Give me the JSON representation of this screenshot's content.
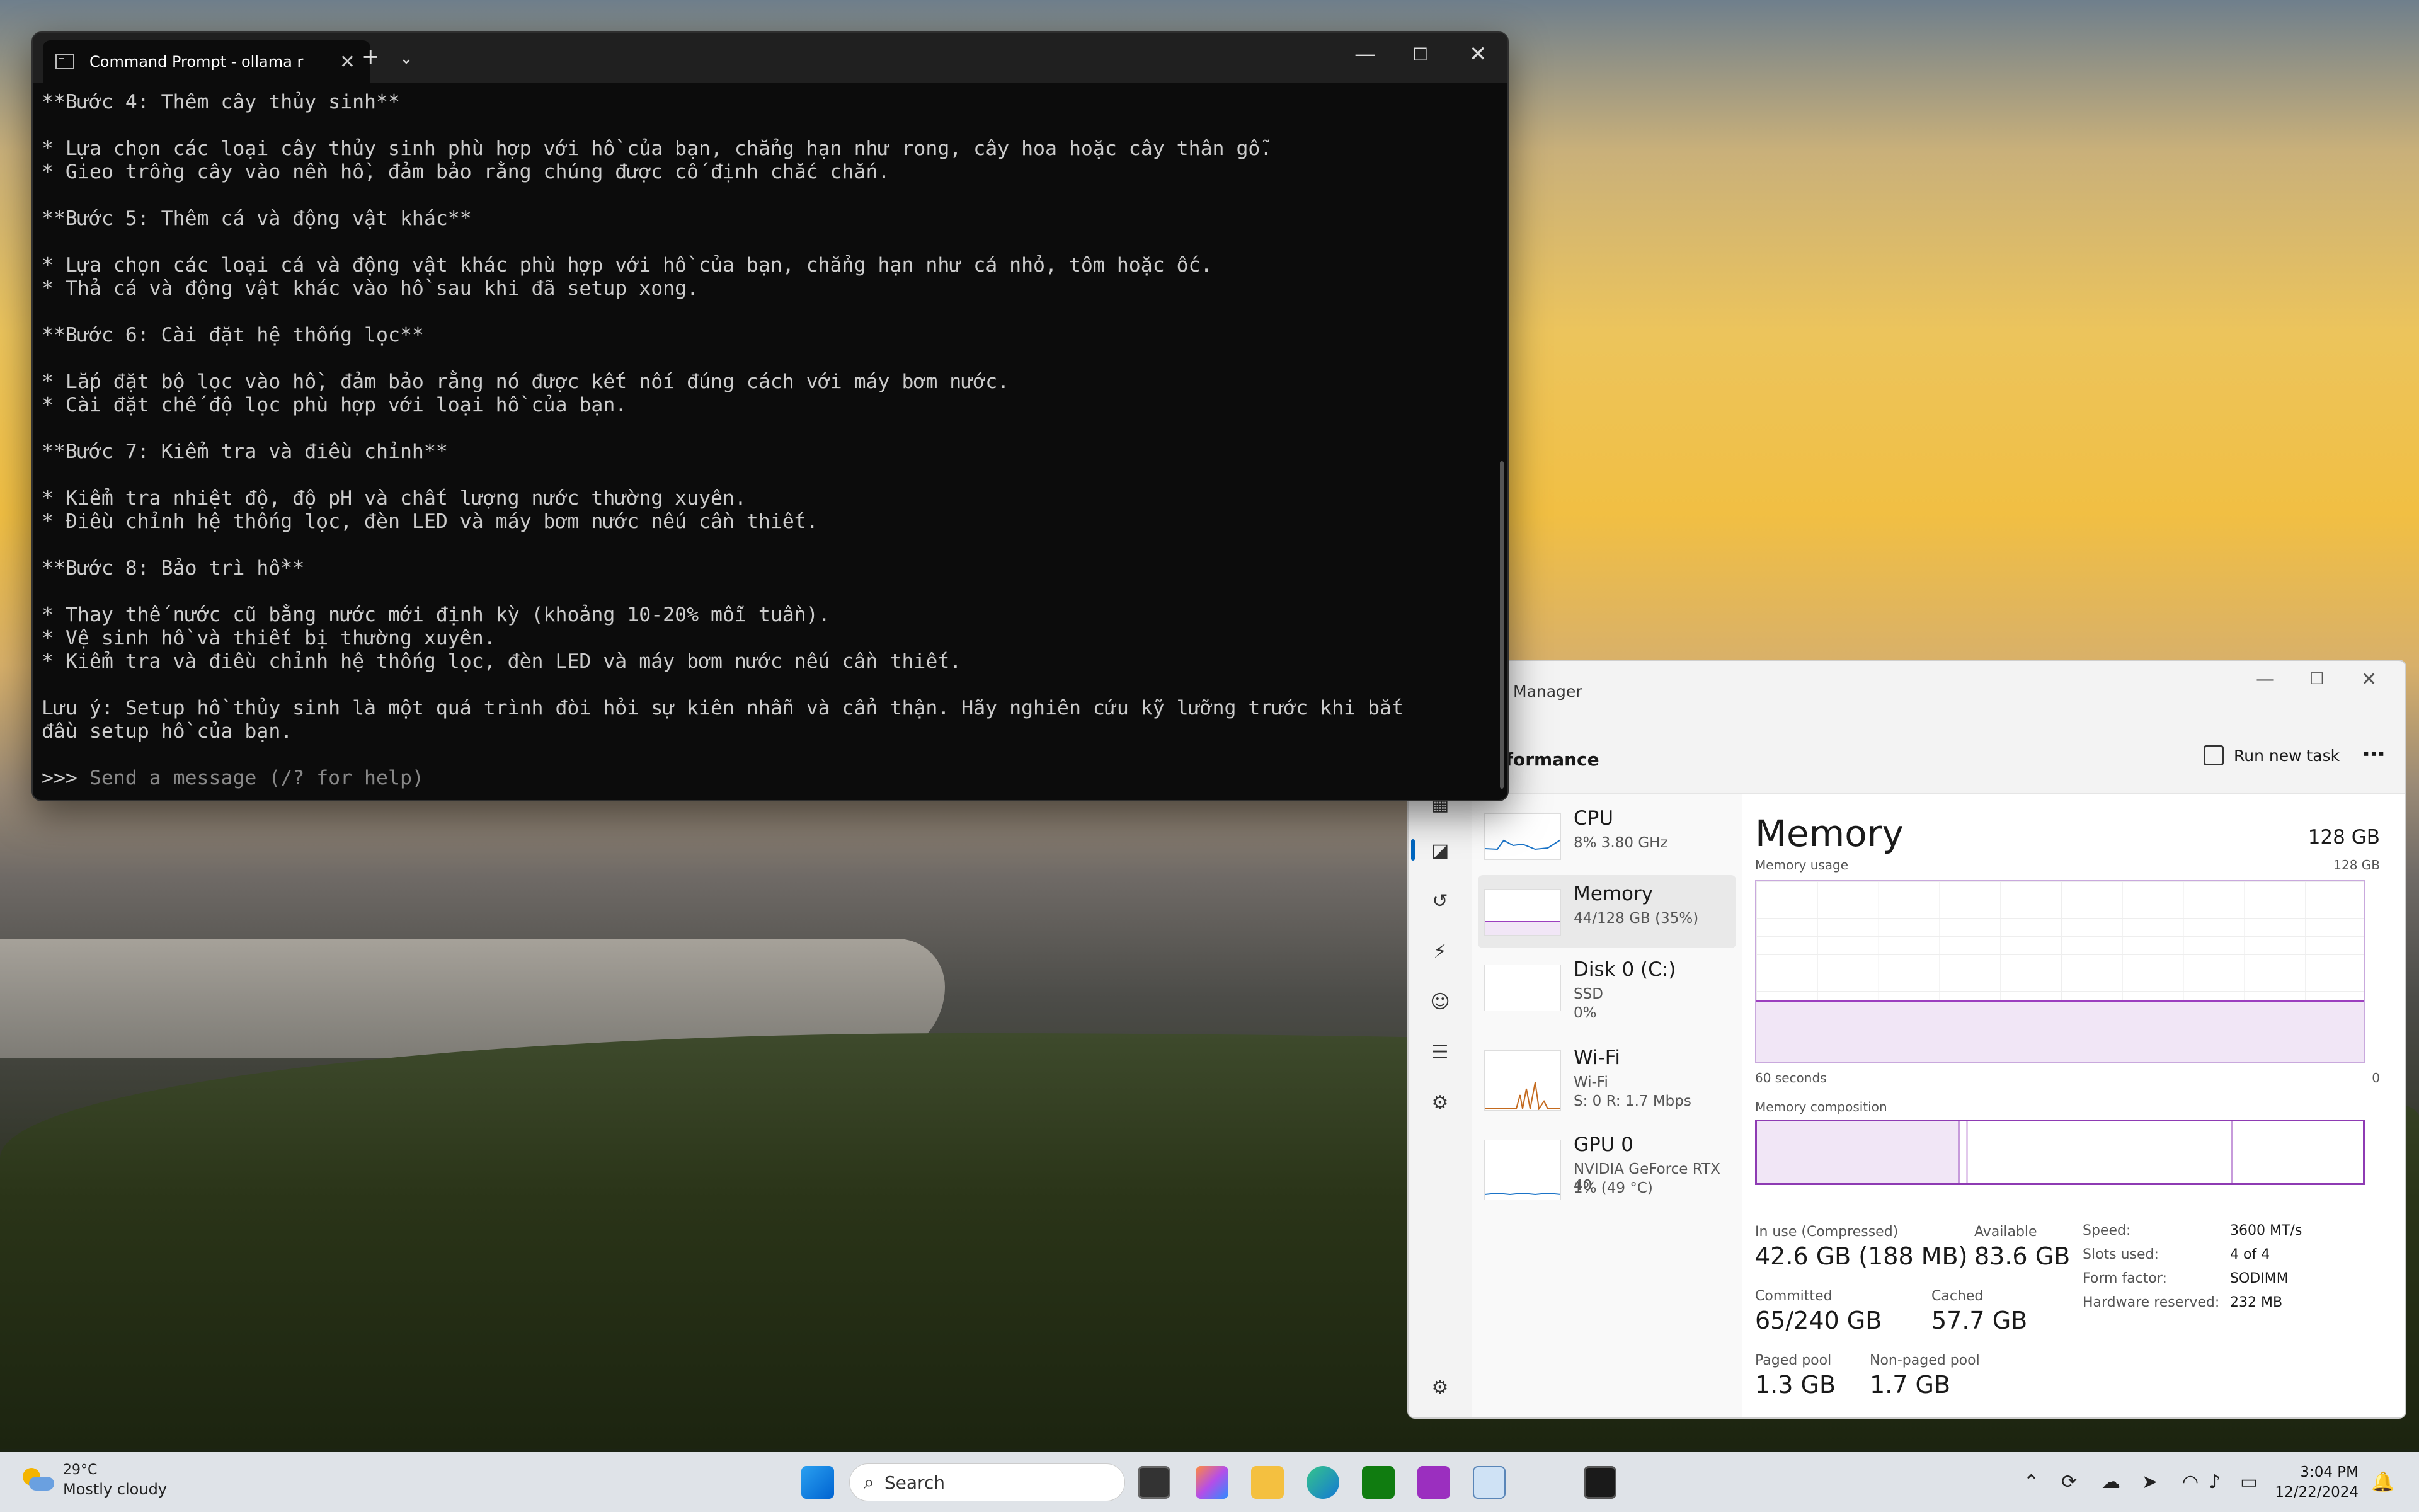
{
  "terminal": {
    "tab_title": "Command Prompt - ollama r",
    "lines": [
      "**Bước 4: Thêm cây thủy sinh**",
      "",
      "* Lựa chọn các loại cây thủy sinh phù hợp với hồ của bạn, chẳng hạn như rong, cây hoa hoặc cây thân gỗ.",
      "* Gieo trồng cây vào nền hồ, đảm bảo rằng chúng được cố định chắc chắn.",
      "",
      "**Bước 5: Thêm cá và động vật khác**",
      "",
      "* Lựa chọn các loại cá và động vật khác phù hợp với hồ của bạn, chẳng hạn như cá nhỏ, tôm hoặc ốc.",
      "* Thả cá và động vật khác vào hồ sau khi đã setup xong.",
      "",
      "**Bước 6: Cài đặt hệ thống lọc**",
      "",
      "* Lắp đặt bộ lọc vào hồ, đảm bảo rằng nó được kết nối đúng cách với máy bơm nước.",
      "* Cài đặt chế độ lọc phù hợp với loại hồ của bạn.",
      "",
      "**Bước 7: Kiểm tra và điều chỉnh**",
      "",
      "* Kiểm tra nhiệt độ, độ pH và chất lượng nước thường xuyên.",
      "* Điều chỉnh hệ thống lọc, đèn LED và máy bơm nước nếu cần thiết.",
      "",
      "**Bước 8: Bảo trì hồ**",
      "",
      "* Thay thế nước cũ bằng nước mới định kỳ (khoảng 10-20% mỗi tuần).",
      "* Vệ sinh hồ và thiết bị thường xuyên.",
      "* Kiểm tra và điều chỉnh hệ thống lọc, đèn LED và máy bơm nước nếu cần thiết.",
      "",
      "Lưu ý: Setup hồ thủy sinh là một quá trình đòi hỏi sự kiên nhẫn và cẩn thận. Hãy nghiên cứu kỹ lưỡng trước khi bắt",
      "đầu setup hồ của bạn.",
      ""
    ],
    "prompt": ">>>",
    "input_placeholder": "Send a message (/? for help)"
  },
  "taskmanager": {
    "window_title": "Manager",
    "section": "rformance",
    "run_new_task": "Run new task",
    "devices": [
      {
        "name": "CPU",
        "sub1": "8% 3.80 GHz",
        "sub2": ""
      },
      {
        "name": "Memory",
        "sub1": "44/128 GB (35%)",
        "sub2": ""
      },
      {
        "name": "Disk 0 (C:)",
        "sub1": "SSD",
        "sub2": "0%"
      },
      {
        "name": "Wi-Fi",
        "sub1": "Wi-Fi",
        "sub2": "S: 0 R: 1.7 Mbps"
      },
      {
        "name": "GPU 0",
        "sub1": "NVIDIA GeForce RTX 40",
        "sub2": "1% (49 °C)"
      }
    ],
    "memory": {
      "title": "Memory",
      "total": "128 GB",
      "usage_label": "Memory usage",
      "usage_max": "128 GB",
      "time_left": "60 seconds",
      "time_right": "0",
      "composition_label": "Memory composition",
      "usage_fraction": 0.34,
      "stats": {
        "in_use_label": "In use (Compressed)",
        "in_use": "42.6 GB (188 MB)",
        "available_label": "Available",
        "available": "83.6 GB",
        "committed_label": "Committed",
        "committed": "65/240 GB",
        "cached_label": "Cached",
        "cached": "57.7 GB",
        "paged_label": "Paged pool",
        "paged": "1.3 GB",
        "nonpaged_label": "Non-paged pool",
        "nonpaged": "1.7 GB"
      },
      "specs": {
        "speed_label": "Speed:",
        "speed": "3600 MT/s",
        "slots_label": "Slots used:",
        "slots": "4 of 4",
        "form_label": "Form factor:",
        "form": "SODIMM",
        "reserved_label": "Hardware reserved:",
        "reserved": "232 MB"
      }
    }
  },
  "taskbar": {
    "weather_temp": "29°C",
    "weather_desc": "Mostly cloudy",
    "search_placeholder": "Search",
    "time": "3:04 PM",
    "date": "12/22/2024"
  },
  "colors": {
    "terminal_bg": "#0c0c0c",
    "memory_accent": "#8e3bb3",
    "accent": "#0067c0"
  }
}
